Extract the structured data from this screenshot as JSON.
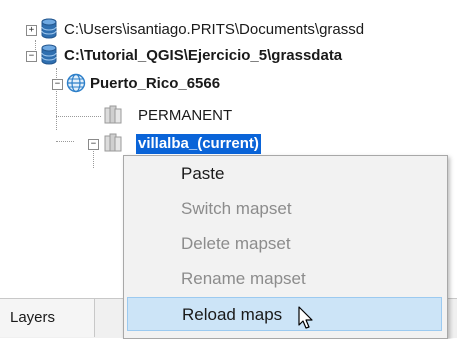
{
  "tree": {
    "items": [
      {
        "label": "C:\\Users\\isantiago.PRITS\\Documents\\grassd"
      },
      {
        "label": "C:\\Tutorial_QGIS\\Ejercicio_5\\grassdata"
      },
      {
        "label": "Puerto_Rico_6566"
      },
      {
        "label": "PERMANENT"
      },
      {
        "label": "villalba_(current)"
      }
    ]
  },
  "context_menu": {
    "items": [
      {
        "label": "Paste",
        "enabled": true
      },
      {
        "label": "Switch mapset",
        "enabled": false
      },
      {
        "label": "Delete mapset",
        "enabled": false
      },
      {
        "label": "Rename mapset",
        "enabled": false
      },
      {
        "label": "Reload maps",
        "enabled": true,
        "highlighted": true
      }
    ]
  },
  "bottom_tabs": {
    "layers_label": "Layers"
  },
  "colors": {
    "selection": "#0a64d8",
    "menu_hover": "#cce4f7",
    "database_icon": "#2f6fb0",
    "globe_icon": "#2d7fc9",
    "mapset_icon": "#c8c8c8"
  }
}
